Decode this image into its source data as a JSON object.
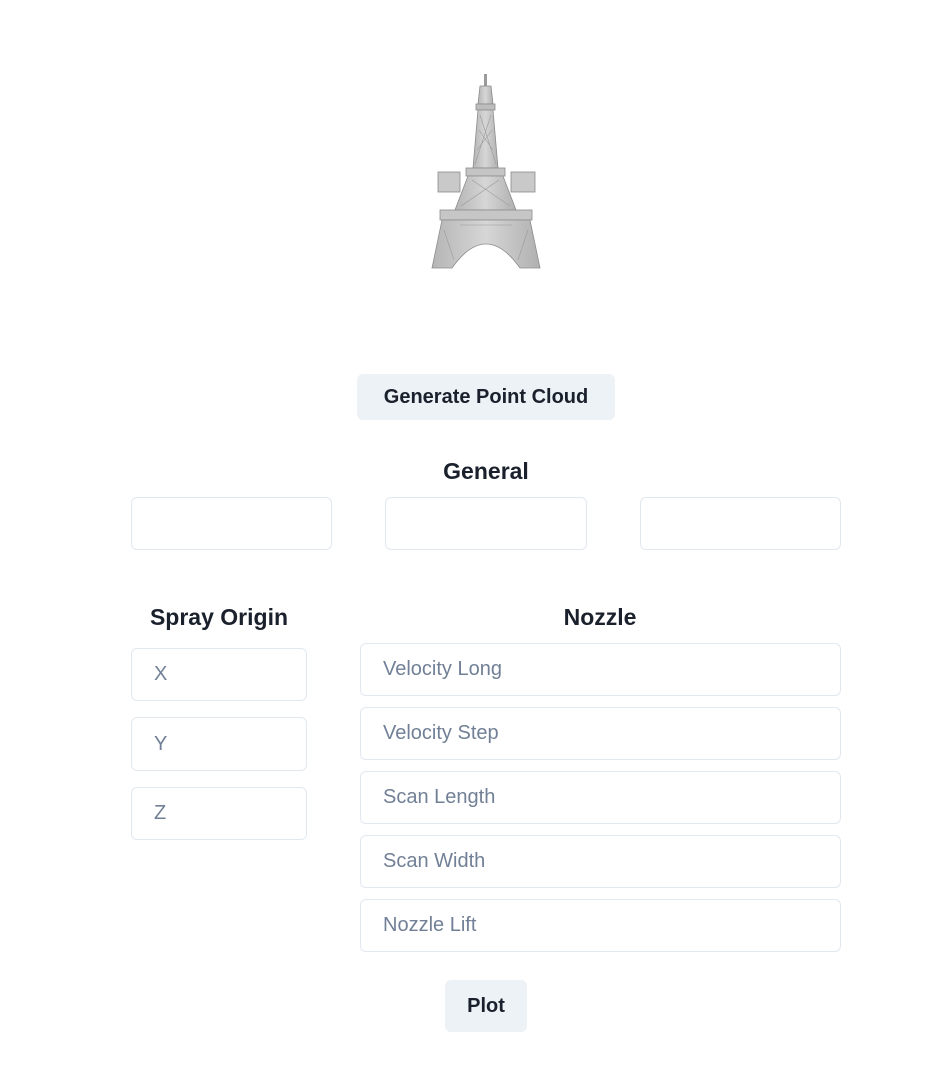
{
  "model": {
    "icon": "eiffel-tower-model",
    "color": "#c8c8c8"
  },
  "actions": {
    "generate_label": "Generate Point Cloud",
    "plot_label": "Plot"
  },
  "general": {
    "heading": "General",
    "fields": [
      {
        "value": "",
        "placeholder": ""
      },
      {
        "value": "",
        "placeholder": ""
      },
      {
        "value": "",
        "placeholder": ""
      }
    ]
  },
  "spray_origin": {
    "heading": "Spray Origin",
    "fields": [
      {
        "placeholder": "X",
        "value": ""
      },
      {
        "placeholder": "Y",
        "value": ""
      },
      {
        "placeholder": "Z",
        "value": ""
      }
    ]
  },
  "nozzle": {
    "heading": "Nozzle",
    "fields": [
      {
        "placeholder": "Velocity Long",
        "value": ""
      },
      {
        "placeholder": "Velocity Step",
        "value": ""
      },
      {
        "placeholder": "Scan Length",
        "value": ""
      },
      {
        "placeholder": "Scan Width",
        "value": ""
      },
      {
        "placeholder": "Nozzle Lift",
        "value": ""
      }
    ]
  },
  "colors": {
    "button_bg": "#edf2f7",
    "border": "#e2e8f0",
    "placeholder": "#718096",
    "text": "#1a202c"
  }
}
